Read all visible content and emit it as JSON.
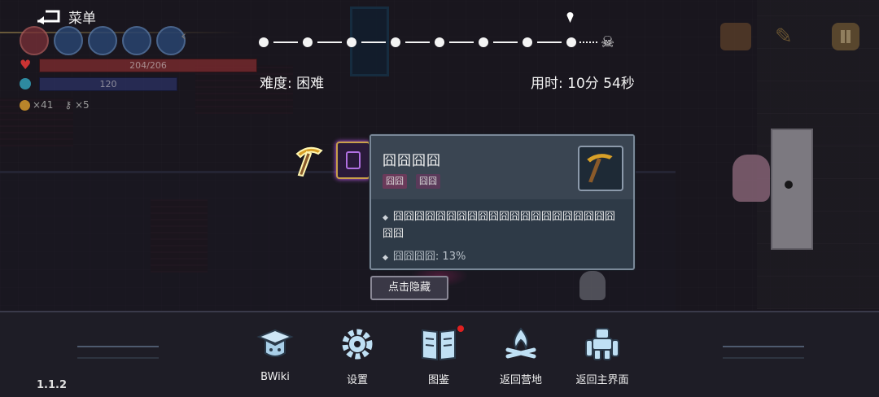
{
  "menu": {
    "label": "菜单",
    "icon": "back-arrow-icon"
  },
  "status": {
    "hp": "204/206",
    "mp": "120",
    "coins": "×41",
    "keys": "×5"
  },
  "progress": {
    "completed_nodes": 8,
    "difficulty": "难度: 困难",
    "time": "用时: 10分 54秒"
  },
  "tooltip": {
    "name": "囧囧囧囧",
    "tags": [
      "囧囧",
      "囧囧"
    ],
    "description": "囧囧囧囧囧囧囧囧囧囧囧囧囧囧囧囧囧囧囧囧囧囧囧",
    "chance": "囧囧囧囧: 13%",
    "icon": "pickaxe-icon"
  },
  "hide_button": "点击隐藏",
  "nav": [
    {
      "label": "BWiki",
      "icon": "graduation-cap-icon"
    },
    {
      "label": "设置",
      "icon": "gear-icon"
    },
    {
      "label": "图鉴",
      "icon": "book-icon",
      "badge": true
    },
    {
      "label": "返回营地",
      "icon": "campfire-icon"
    },
    {
      "label": "返回主界面",
      "icon": "golem-icon"
    }
  ],
  "version": "1.1.2",
  "colors": {
    "accent_gold": "#c9a04a",
    "tooltip_bg": "#2e3a47",
    "hp": "#7a2a2e",
    "mp": "#2a3060",
    "badge": "#e02020"
  }
}
